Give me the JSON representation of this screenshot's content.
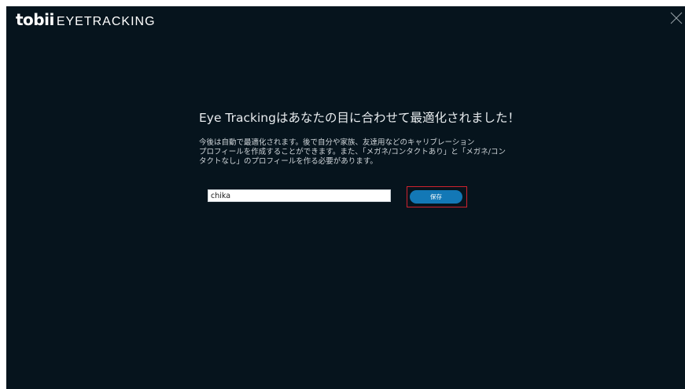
{
  "app": {
    "logo_text": "tobii",
    "product_text": "EYETRACKING"
  },
  "header": {
    "close_icon": "close-icon"
  },
  "main": {
    "heading": "Eye Trackingはあなたの目に合わせて最適化されました！",
    "description_lines": [
      "今後は自動で最適化されます。後で自分や家族、友達用などのキャリブレーション",
      "プロフィールを作成することができます。また、「メガネ/コンタクトあり」と「メガネ/コン",
      "タクトなし」のプロフィールを作る必要があります。"
    ],
    "profile_name_value": "chika",
    "save_label": "保存"
  },
  "colors": {
    "background": "#06141d",
    "accent": "#1378b6",
    "highlight": "#d0222e"
  }
}
